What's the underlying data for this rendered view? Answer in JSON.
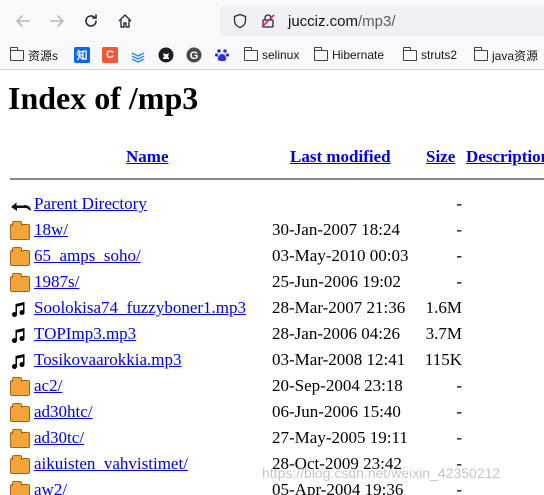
{
  "browser": {
    "url_host": "jucciz.com",
    "url_path": "/mp3/",
    "bookmarks": [
      {
        "label": "资源s",
        "icon": "folder-icon"
      },
      {
        "label": "知",
        "icon": "zhihu-icon"
      },
      {
        "label": "C",
        "icon": "csdn-icon"
      },
      {
        "label": "",
        "icon": "stack-icon"
      },
      {
        "label": "",
        "icon": "github-icon"
      },
      {
        "label": "",
        "icon": "g-icon"
      },
      {
        "label": "",
        "icon": "baidu-icon"
      },
      {
        "label": "selinux",
        "icon": "folder-icon"
      },
      {
        "label": "Hibernate",
        "icon": "folder-icon"
      },
      {
        "label": "struts2",
        "icon": "folder-icon"
      },
      {
        "label": "java资源",
        "icon": "folder-icon"
      }
    ]
  },
  "page": {
    "title": "Index of /mp3",
    "columns": {
      "name": "Name",
      "modified": "Last modified",
      "size": "Size",
      "description": "Description"
    },
    "rows": [
      {
        "icon": "back-icon",
        "name": "Parent Directory",
        "date": "",
        "size": "-"
      },
      {
        "icon": "folder-icon",
        "name": "18w/",
        "date": "30-Jan-2007 18:24",
        "size": "-"
      },
      {
        "icon": "folder-icon",
        "name": "65_amps_soho/",
        "date": "03-May-2010 00:03",
        "size": "-"
      },
      {
        "icon": "folder-icon",
        "name": "1987s/",
        "date": "25-Jun-2006 19:02",
        "size": "-"
      },
      {
        "icon": "music-icon",
        "name": "Soolokisa74_fuzzyboner1.mp3",
        "date": "28-Mar-2007 21:36",
        "size": "1.6M"
      },
      {
        "icon": "music-icon",
        "name": "TOPImp3.mp3",
        "date": "28-Jan-2006 04:26",
        "size": "3.7M"
      },
      {
        "icon": "music-icon",
        "name": "Tosikovaarokkia.mp3",
        "date": "03-Mar-2008 12:41",
        "size": "115K"
      },
      {
        "icon": "folder-icon",
        "name": "ac2/",
        "date": "20-Sep-2004 23:18",
        "size": "-"
      },
      {
        "icon": "folder-icon",
        "name": "ad30htc/",
        "date": "06-Jun-2006 15:40",
        "size": "-"
      },
      {
        "icon": "folder-icon",
        "name": "ad30tc/",
        "date": "27-May-2005 19:11",
        "size": "-"
      },
      {
        "icon": "folder-icon",
        "name": "aikuisten_vahvistimet/",
        "date": "28-Oct-2009 23:42",
        "size": "-"
      },
      {
        "icon": "folder-icon",
        "name": "aw2/",
        "date": "05-Apr-2004 19:36",
        "size": "-"
      }
    ]
  },
  "watermark": "https://blog.csdn.net/weixin_42350212",
  "colors": {
    "link": "#0000ee",
    "folder": "#f4a43a"
  }
}
